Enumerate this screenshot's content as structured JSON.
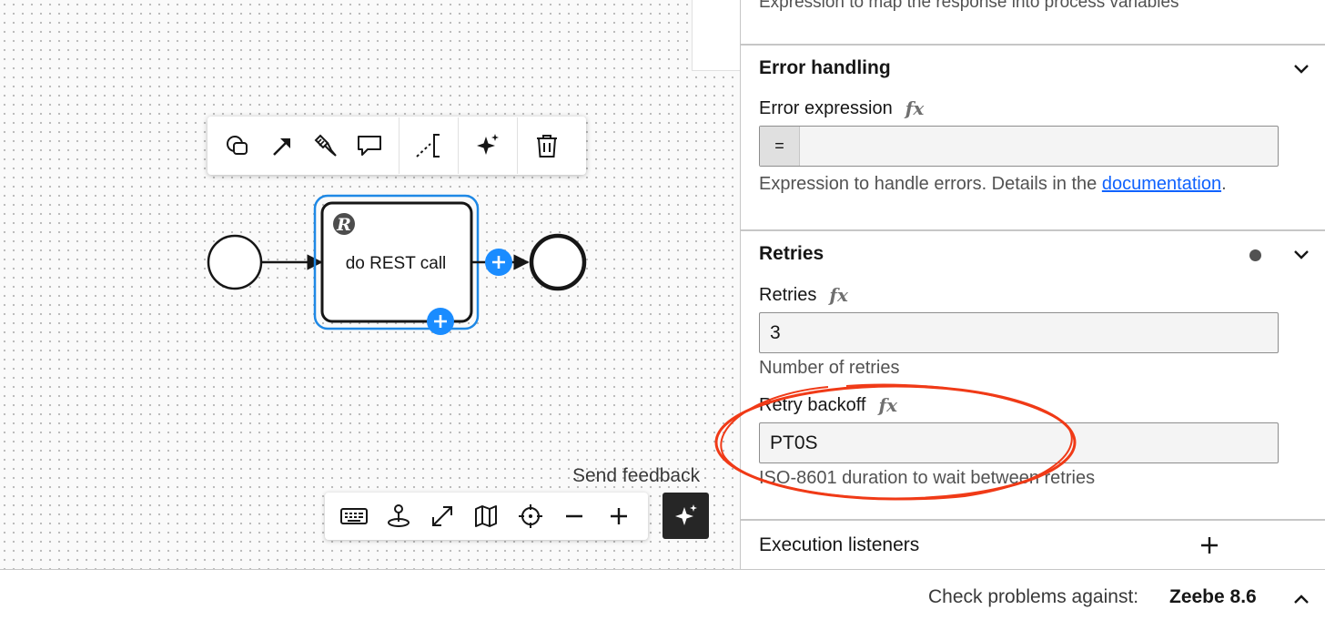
{
  "canvas": {
    "task": {
      "name": "do REST call",
      "marker": "R"
    },
    "context_pad": {
      "icons": [
        "shapes-icon",
        "connect-arrow-icon",
        "paint-brush-icon",
        "comment-icon",
        "text-annotation-icon",
        "ai-sparkle-icon",
        "trash-icon"
      ]
    },
    "toolbar": {
      "icons": [
        "keyboard-icon",
        "joystick-icon",
        "fullscreen-icon",
        "minimap-icon",
        "reset-view-icon",
        "zoom-out-icon",
        "zoom-in-icon"
      ]
    },
    "send_feedback": "Send feedback"
  },
  "panel": {
    "previous_description": "Expression to map the response into process variables",
    "error_handling": {
      "title": "Error handling",
      "error_expression": {
        "label": "Error expression",
        "fx": "fx",
        "prefix": "=",
        "value": ""
      },
      "description_prefix": "Expression to handle errors. Details in the ",
      "description_link": "documentation",
      "description_suffix": "."
    },
    "retries": {
      "title": "Retries",
      "retries_field": {
        "label": "Retries",
        "fx": "fx",
        "value": "3",
        "description": "Number of retries"
      },
      "retry_backoff": {
        "label": "Retry backoff",
        "fx": "fx",
        "value": "PT0S",
        "description": "ISO-8601 duration to wait between retries"
      }
    },
    "execution_listeners": {
      "title": "Execution listeners"
    }
  },
  "status_bar": {
    "check_label": "Check problems against:",
    "engine_version": "Zeebe 8.6"
  },
  "colors": {
    "selection": "#1e88e5",
    "add_button": "#1a8cff",
    "annotation": "#f03a17"
  }
}
